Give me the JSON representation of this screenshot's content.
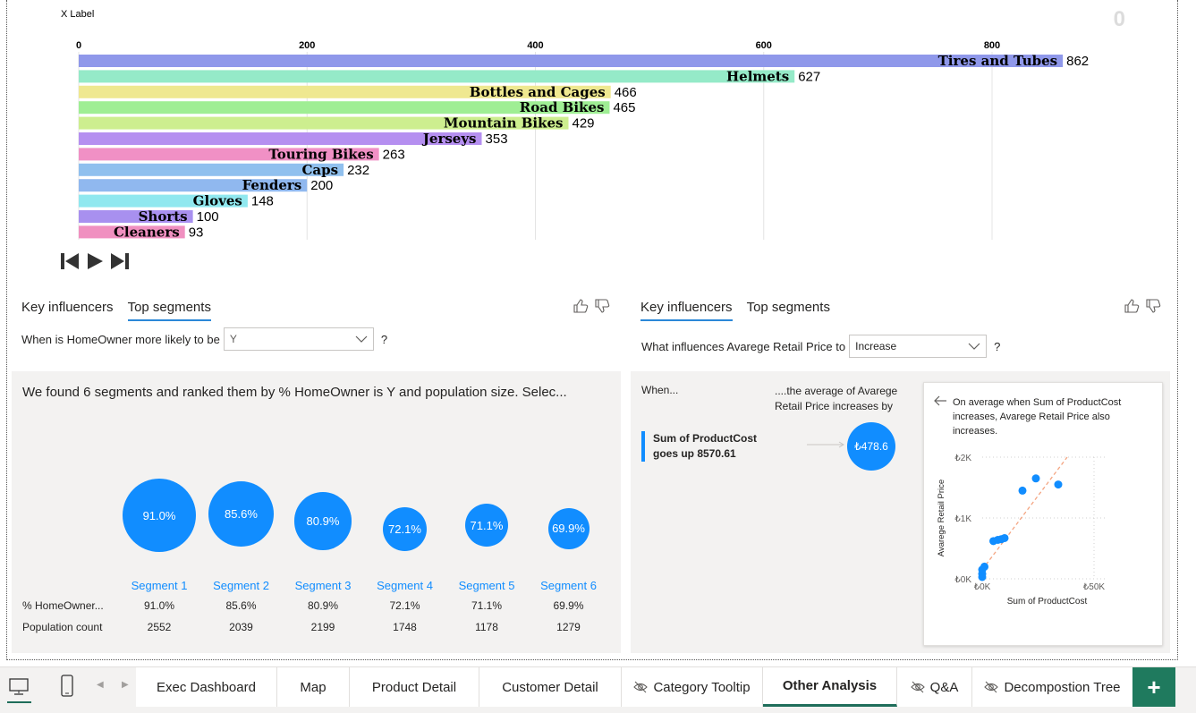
{
  "race_chart": {
    "frame_counter": "0",
    "controls": {
      "first": "skip-to-start",
      "play": "play",
      "last": "skip-to-end"
    }
  },
  "chart_data": {
    "type": "bar",
    "xlabel": "X Label",
    "xlim": [
      0,
      880
    ],
    "xticks": [
      0,
      200,
      400,
      600,
      800
    ],
    "categories": [
      "Tires and Tubes",
      "Helmets",
      "Bottles and Cages",
      "Road Bikes",
      "Mountain Bikes",
      "Jerseys",
      "Touring Bikes",
      "Caps",
      "Fenders",
      "Gloves",
      "Shorts",
      "Cleaners"
    ],
    "values": [
      862,
      627,
      466,
      465,
      429,
      353,
      263,
      232,
      200,
      148,
      100,
      93
    ],
    "colors": [
      "#8f98ea",
      "#95eac8",
      "#efe890",
      "#9fee94",
      "#cdee8f",
      "#b58ff0",
      "#f090c5",
      "#90c0ee",
      "#90b8ef",
      "#90e8ef",
      "#a890ef",
      "#f090c0"
    ]
  },
  "left_visual": {
    "tabs": [
      "Key influencers",
      "Top segments"
    ],
    "active_tab": 1,
    "question": "When is HomeOwner more likely to be",
    "dropdown_value": "Y",
    "qmark": "?",
    "summary": "We found 6 segments and ranked them by % HomeOwner is Y and population size. Selec...",
    "row_heads": [
      "% HomeOwner...",
      "Population count"
    ],
    "segments": [
      {
        "name": "Segment 1",
        "pct": "91.0%",
        "population": "2552"
      },
      {
        "name": "Segment 2",
        "pct": "85.6%",
        "population": "2039"
      },
      {
        "name": "Segment 3",
        "pct": "80.9%",
        "population": "2199"
      },
      {
        "name": "Segment 4",
        "pct": "72.1%",
        "population": "1748"
      },
      {
        "name": "Segment 5",
        "pct": "71.1%",
        "population": "1178"
      },
      {
        "name": "Segment 6",
        "pct": "69.9%",
        "population": "1279"
      }
    ]
  },
  "right_visual": {
    "tabs": [
      "Key influencers",
      "Top segments"
    ],
    "active_tab": 0,
    "question": "What influences Avarege Retail Price to",
    "dropdown_value": "Increase",
    "qmark": "?",
    "col_when": "When...",
    "col_then": "....the average of Avarege Retail Price increases by",
    "factor": "Sum of ProductCost goes up 8570.61",
    "impact": "₺478.6",
    "detail_text": "On average when Sum of ProductCost increases, Avarege Retail Price also increases.",
    "scatter": {
      "ylabel": "Avarege Retail Price",
      "xlabel": "Sum of ProductCost",
      "yticks": [
        "₺2K",
        "₺1K",
        "₺0K"
      ],
      "xticks": [
        "₺0K",
        "₺50K"
      ],
      "points": [
        [
          0,
          30
        ],
        [
          0,
          80
        ],
        [
          0,
          150
        ],
        [
          1000,
          200
        ],
        [
          5000,
          620
        ],
        [
          7000,
          640
        ],
        [
          8500,
          650
        ],
        [
          10000,
          670
        ],
        [
          18000,
          1450
        ],
        [
          24000,
          1650
        ],
        [
          34000,
          1550
        ]
      ]
    }
  },
  "page_tabs": {
    "tabs": [
      {
        "label": "Exec Dashboard",
        "hidden": false
      },
      {
        "label": "Map",
        "hidden": false
      },
      {
        "label": "Product Detail",
        "hidden": false
      },
      {
        "label": "Customer Detail",
        "hidden": false
      },
      {
        "label": "Category Tooltip",
        "hidden": true
      },
      {
        "label": "Other Analysis",
        "hidden": false
      },
      {
        "label": "Q&A",
        "hidden": true
      },
      {
        "label": "Decompostion Tree",
        "hidden": true
      }
    ],
    "active_tab": 5,
    "add_label": "+"
  },
  "colors": {
    "accent": "#118dff",
    "active_page_underline": "#1f6e5b",
    "add_button": "#1f7a5e"
  }
}
